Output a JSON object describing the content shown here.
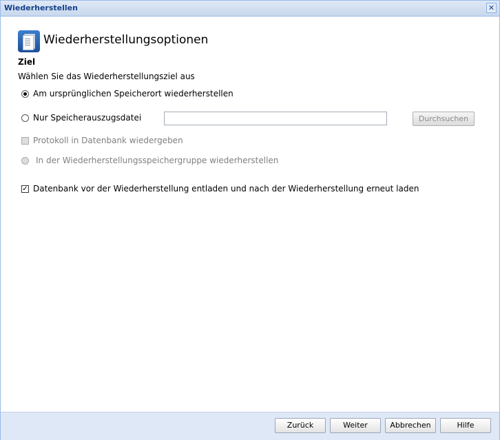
{
  "window": {
    "title": "Wiederherstellen"
  },
  "header": {
    "title": "Wiederherstellungsoptionen"
  },
  "section": {
    "title": "Ziel",
    "subtitle": "Wählen Sie das Wiederherstellungsziel aus"
  },
  "options": {
    "original_location": "Am ursprünglichen Speicherort wiederherstellen",
    "dump_file_only": "Nur Speicherauszugsdatei",
    "dump_file_value": "",
    "browse": "Durchsuchen",
    "replay_log": "Protokoll in Datenbank wiedergeben",
    "recovery_storage_group": "In der Wiederherstellungsspeichergruppe wiederherstellen",
    "unmount_remount": "Datenbank vor der Wiederherstellung entladen und nach der Wiederherstellung erneut laden"
  },
  "footer": {
    "back": "Zurück",
    "next": "Weiter",
    "cancel": "Abbrechen",
    "help": "Hilfe"
  }
}
